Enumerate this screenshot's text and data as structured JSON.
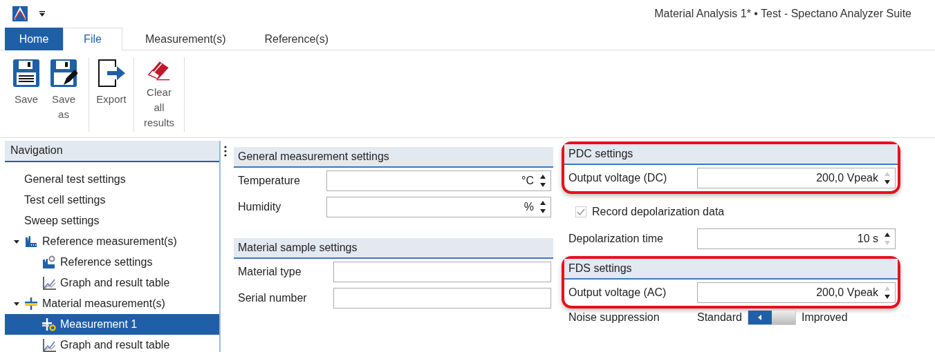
{
  "window": {
    "title": "Material Analysis 1* • Test - Spectano Analyzer Suite"
  },
  "tabs": [
    {
      "label": "Home",
      "kind": "home",
      "selected": false
    },
    {
      "label": "File",
      "kind": "tab",
      "selected": true
    },
    {
      "label": "Measurement(s)",
      "kind": "tab",
      "selected": false
    },
    {
      "label": "Reference(s)",
      "kind": "tab",
      "selected": false
    }
  ],
  "ribbon": {
    "groups": [
      [
        {
          "label": "Save",
          "kind": "save"
        },
        {
          "label": "Save as",
          "kind": "saveas"
        }
      ],
      [
        {
          "label": "Export",
          "kind": "export"
        }
      ],
      [
        {
          "label": "Clear all results",
          "kind": "clear"
        }
      ]
    ]
  },
  "navigation": {
    "title": "Navigation",
    "items": [
      {
        "label": "General test settings",
        "kind": "plain",
        "selected": false
      },
      {
        "label": "Test cell settings",
        "kind": "plain",
        "selected": false
      },
      {
        "label": "Sweep settings",
        "kind": "plain",
        "selected": false
      },
      {
        "label": "Reference measurement(s)",
        "kind": "reference",
        "selected": false,
        "expanded": true,
        "children": [
          {
            "label": "Reference settings",
            "kind": "refsettings",
            "selected": false
          },
          {
            "label": "Graph and result table",
            "kind": "graph",
            "selected": false
          }
        ]
      },
      {
        "label": "Material measurement(s)",
        "kind": "material",
        "selected": false,
        "expanded": true,
        "children": [
          {
            "label": "Measurement 1",
            "kind": "measurement",
            "selected": true
          },
          {
            "label": "Graph and result table",
            "kind": "graph",
            "selected": false
          }
        ]
      }
    ]
  },
  "middle_sections": [
    {
      "title": "General measurement settings",
      "highlighted": false,
      "fields": [
        {
          "label": "Temperature",
          "kind": "spin",
          "value": "°C",
          "up_enabled": true,
          "down_enabled": true
        },
        {
          "label": "Humidity",
          "kind": "spin",
          "value": "%",
          "up_enabled": true,
          "down_enabled": true
        }
      ]
    },
    {
      "title": "Material sample settings",
      "highlighted": false,
      "fields": [
        {
          "label": "Material type",
          "kind": "text"
        },
        {
          "label": "Serial number",
          "kind": "text"
        }
      ]
    }
  ],
  "right_sections": [
    {
      "title": "PDC settings",
      "highlighted": true,
      "fields": [
        {
          "label": "Output voltage (DC)",
          "kind": "spin",
          "value": "200,0 Vpeak",
          "up_enabled": false,
          "down_enabled": true
        }
      ]
    },
    {
      "kind": "checkbox",
      "label": "Record depolarization data",
      "checked": true,
      "disabled": true
    },
    {
      "kind": "spin",
      "label": "Depolarization time",
      "value": "10 s",
      "up_enabled": true,
      "down_enabled": false
    },
    {
      "title": "FDS settings",
      "highlighted": true,
      "fields": [
        {
          "label": "Output voltage (AC)",
          "kind": "spin",
          "value": "200,0 Vpeak",
          "up_enabled": false,
          "down_enabled": true
        }
      ]
    },
    {
      "kind": "toggle",
      "label": "Noise suppression",
      "off_label": "Standard",
      "on_label": "Improved",
      "on": false
    }
  ]
}
